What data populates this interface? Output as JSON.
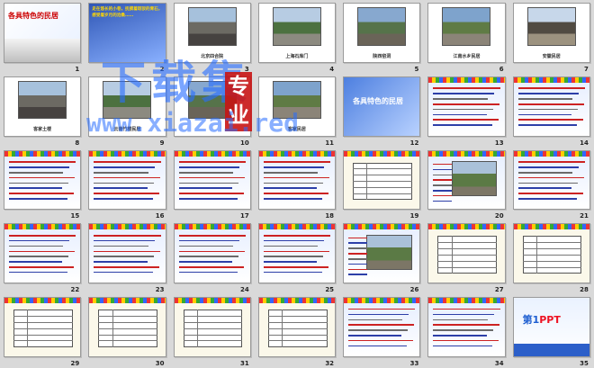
{
  "slides": [
    {
      "n": "1",
      "kind": "title",
      "title": "各具特色的民居"
    },
    {
      "n": "2",
      "kind": "poem",
      "text": "走在悠长的小巷，抚摸着斑驳的青石，感受着岁月的沧桑……"
    },
    {
      "n": "3",
      "kind": "photo",
      "caption": "北京四合院"
    },
    {
      "n": "4",
      "kind": "photo",
      "caption": "上海石库门"
    },
    {
      "n": "5",
      "kind": "photo",
      "caption": "陕西窑洞"
    },
    {
      "n": "6",
      "kind": "photo",
      "caption": "江南水乡民居"
    },
    {
      "n": "7",
      "kind": "photo",
      "caption": "安徽民居"
    },
    {
      "n": "8",
      "kind": "photo",
      "caption": "客家土楼"
    },
    {
      "n": "9",
      "kind": "photo",
      "caption": "云南竹楼民居"
    },
    {
      "n": "10",
      "kind": "photo",
      "caption": ""
    },
    {
      "n": "11",
      "kind": "photo",
      "caption": "客家民居"
    },
    {
      "n": "12",
      "kind": "blue-title",
      "title": "各具特色的民居"
    },
    {
      "n": "13",
      "kind": "text",
      "caption": ""
    },
    {
      "n": "14",
      "kind": "text",
      "caption": ""
    },
    {
      "n": "15",
      "kind": "text",
      "caption": ""
    },
    {
      "n": "16",
      "kind": "text",
      "caption": ""
    },
    {
      "n": "17",
      "kind": "text",
      "caption": ""
    },
    {
      "n": "18",
      "kind": "text",
      "caption": ""
    },
    {
      "n": "19",
      "kind": "table",
      "caption": ""
    },
    {
      "n": "20",
      "kind": "photo-text",
      "caption": ""
    },
    {
      "n": "21",
      "kind": "text",
      "caption": ""
    },
    {
      "n": "22",
      "kind": "text",
      "caption": ""
    },
    {
      "n": "23",
      "kind": "text",
      "caption": ""
    },
    {
      "n": "24",
      "kind": "text",
      "caption": ""
    },
    {
      "n": "25",
      "kind": "text",
      "caption": ""
    },
    {
      "n": "26",
      "kind": "photo-text",
      "caption": ""
    },
    {
      "n": "27",
      "kind": "table",
      "caption": ""
    },
    {
      "n": "28",
      "kind": "table",
      "caption": ""
    },
    {
      "n": "29",
      "kind": "table",
      "caption": ""
    },
    {
      "n": "30",
      "kind": "table",
      "caption": ""
    },
    {
      "n": "31",
      "kind": "table",
      "caption": ""
    },
    {
      "n": "32",
      "kind": "table",
      "caption": ""
    },
    {
      "n": "33",
      "kind": "text",
      "caption": ""
    },
    {
      "n": "34",
      "kind": "text",
      "caption": ""
    },
    {
      "n": "35",
      "kind": "ppt",
      "logo_main": "第1",
      "logo_accent": "PPT"
    }
  ],
  "watermark": {
    "main": "下载集",
    "seal": "专业",
    "url": "www.xiazai.red"
  }
}
